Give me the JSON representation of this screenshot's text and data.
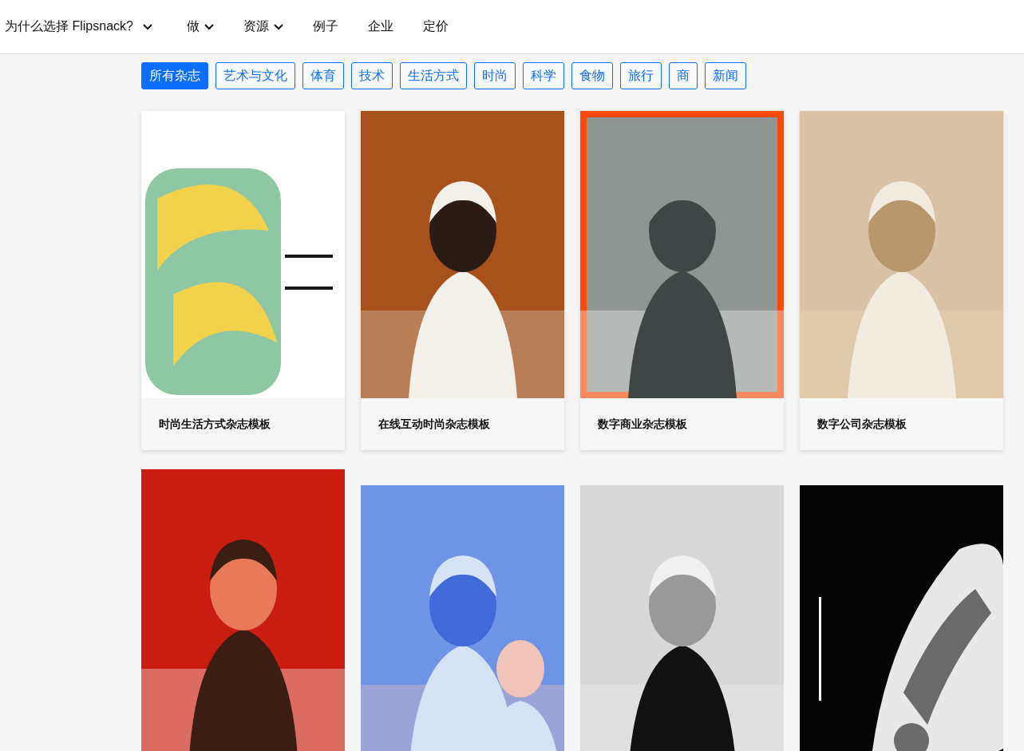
{
  "nav": [
    {
      "label": "为什么选择 Flipsnack?",
      "has_menu": true
    },
    {
      "label": "做",
      "has_menu": true
    },
    {
      "label": "资源",
      "has_menu": true
    },
    {
      "label": "例子",
      "has_menu": false
    },
    {
      "label": "企业",
      "has_menu": false
    },
    {
      "label": "定价",
      "has_menu": false
    }
  ],
  "filters": [
    {
      "label": "所有杂志",
      "selected": true
    },
    {
      "label": "艺术与文化",
      "selected": false
    },
    {
      "label": "体育",
      "selected": false
    },
    {
      "label": "技术",
      "selected": false
    },
    {
      "label": "生活方式",
      "selected": false
    },
    {
      "label": "时尚",
      "selected": false
    },
    {
      "label": "科学",
      "selected": false
    },
    {
      "label": "食物",
      "selected": false
    },
    {
      "label": "旅行",
      "selected": false
    },
    {
      "label": "商",
      "selected": false
    },
    {
      "label": "新闻",
      "selected": false
    }
  ],
  "cards": [
    {
      "kind": "template",
      "title": "时尚生活方式杂志模板"
    },
    {
      "kind": "template",
      "title": "在线互动时尚杂志模板"
    },
    {
      "kind": "template",
      "title": "数字商业杂志模板"
    },
    {
      "kind": "template",
      "title": "数字公司杂志模板"
    },
    {
      "kind": "cover"
    },
    {
      "kind": "cover"
    },
    {
      "kind": "cover"
    },
    {
      "kind": "cover"
    }
  ]
}
